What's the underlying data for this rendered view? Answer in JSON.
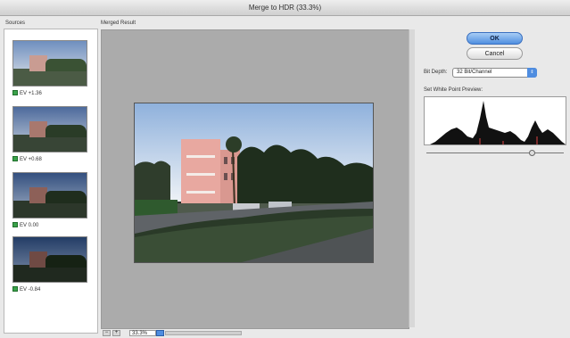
{
  "window": {
    "title": "Merge to HDR (33.3%)"
  },
  "sources": {
    "label": "Sources",
    "items": [
      {
        "ev": "EV +1.36",
        "checked": true
      },
      {
        "ev": "EV +0.68",
        "checked": true
      },
      {
        "ev": "EV 0.00",
        "checked": true
      },
      {
        "ev": "EV -0.84",
        "checked": true
      }
    ]
  },
  "preview": {
    "label": "Merged Result",
    "zoom_value": "33.3%"
  },
  "buttons": {
    "ok": "OK",
    "cancel": "Cancel"
  },
  "bit_depth": {
    "label": "Bit Depth:",
    "selected": "32 Bit/Channel"
  },
  "white_point": {
    "label": "Set White Point Preview:",
    "level": 0.78
  },
  "colors": {
    "accent": "#4f8de0",
    "checkbox": "#3aa24a",
    "preview_bg": "#ababab"
  },
  "icons": {
    "zoom_out": "minus-icon",
    "zoom_in": "plus-icon",
    "zoom_menu": "dropdown-arrow-icon",
    "select_arrows": "updown-arrows-icon"
  }
}
